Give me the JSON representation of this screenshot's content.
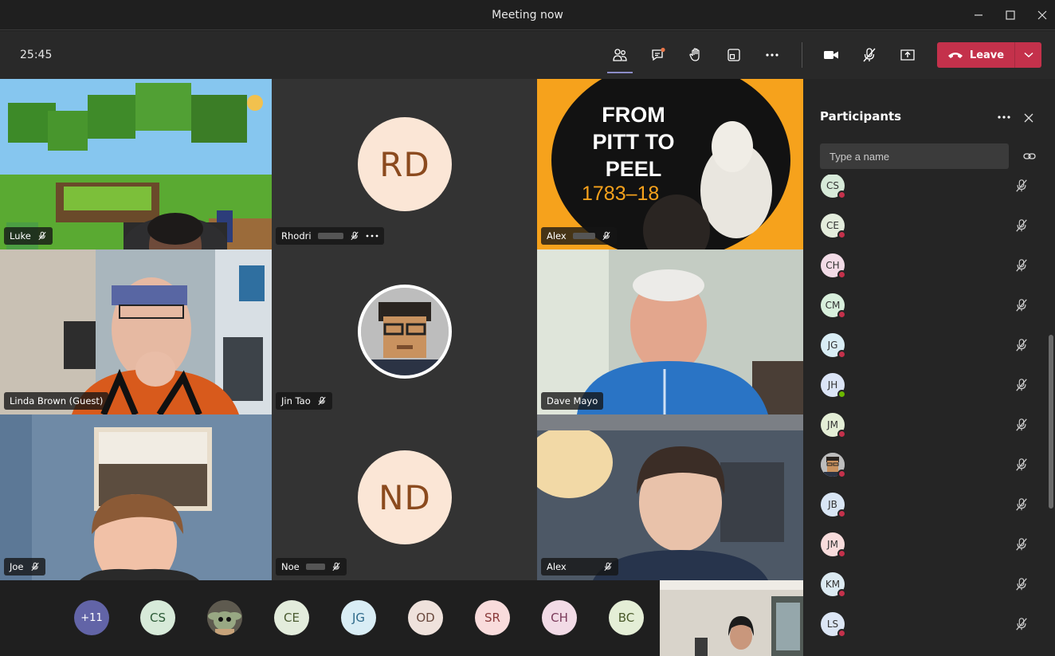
{
  "window": {
    "title": "Meeting now"
  },
  "toolbar": {
    "timer": "25:45",
    "leave_label": "Leave"
  },
  "tiles": [
    {
      "name": "Luke"
    },
    {
      "name": "Rhodri",
      "initials": "RD"
    },
    {
      "name": "Alex",
      "slide": {
        "line1": "FROM",
        "line2": "PITT TO",
        "line3": "PEEL",
        "line4": "1783–18"
      }
    },
    {
      "name": "Linda Brown (Guest)"
    },
    {
      "name": "Jin Tao"
    },
    {
      "name": "Dave Mayo"
    },
    {
      "name": "Joe"
    },
    {
      "name": "Noe",
      "initials": "ND"
    },
    {
      "name": "Alex"
    }
  ],
  "strip": {
    "overflow": "+11",
    "chips": [
      "CS",
      "CE",
      "JG",
      "OD",
      "SR",
      "CH",
      "BC"
    ]
  },
  "panel": {
    "title": "Participants",
    "search_placeholder": "Type a name",
    "participants": [
      {
        "initials": "CS",
        "color": "#d7ead9",
        "status": "busy"
      },
      {
        "initials": "CE",
        "color": "#e3ecdc",
        "status": "busy"
      },
      {
        "initials": "CH",
        "color": "#f2dbe6",
        "status": "busy"
      },
      {
        "initials": "CM",
        "color": "#d8efdc",
        "status": "busy"
      },
      {
        "initials": "JG",
        "color": "#d9edf5",
        "status": "busy"
      },
      {
        "initials": "JH",
        "color": "#dbe4f6",
        "status": "available"
      },
      {
        "initials": "JM",
        "color": "#e4eed6",
        "status": "busy"
      },
      {
        "initials": "",
        "color": "#9aa0a6",
        "status": "busy"
      },
      {
        "initials": "JB",
        "color": "#d9e6f5",
        "status": "busy"
      },
      {
        "initials": "JM",
        "color": "#f8dcdc",
        "status": "busy"
      },
      {
        "initials": "KM",
        "color": "#dceaf2",
        "status": "busy"
      },
      {
        "initials": "LS",
        "color": "#dce6f5",
        "status": "busy"
      }
    ]
  },
  "colors": {
    "accent": "#8b8cc7",
    "leave": "#c4314b",
    "busy": "#c4314b",
    "available": "#6bb700"
  }
}
